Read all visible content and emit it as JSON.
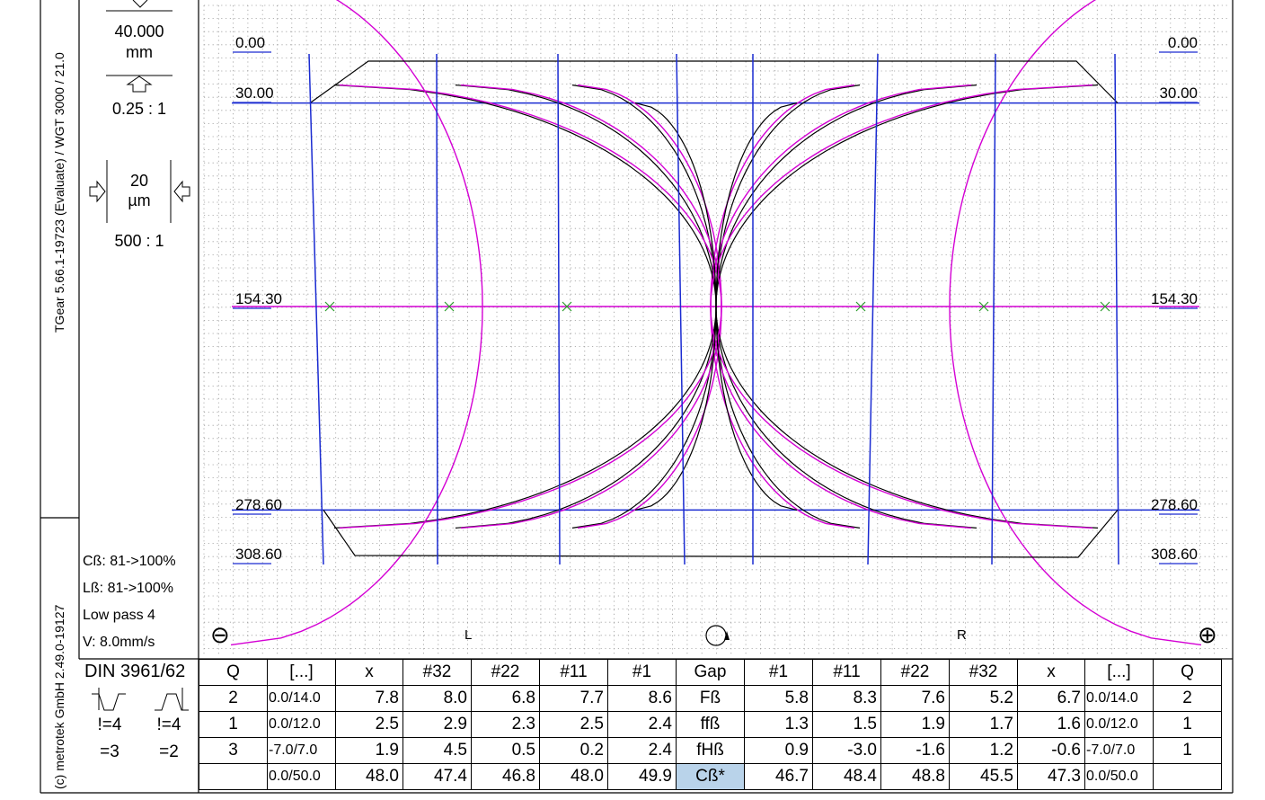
{
  "sidebar": {
    "vertical_top": "TGear 5.66.1-19723 (Evaluate) / WGT 3000 / 21.0",
    "vertical_bottom": "(c) metrotek GmbH 2.49.0-19127",
    "length_value": "40.000",
    "length_unit": "mm",
    "length_scale": "0.25 : 1",
    "deviation_value": "20",
    "deviation_unit": "µm",
    "deviation_scale": "500 : 1",
    "info": [
      "Cß: 81->100%",
      "Lß: 81->100%",
      "Low pass 4",
      "V: 8.0mm/s"
    ],
    "standard": "DIN 3961/62",
    "q_left": "!=4",
    "q_right": "!=4",
    "eq_left": "=3",
    "eq_right": "=2"
  },
  "plot": {
    "row_labels_left": [
      "0.00",
      "30.00",
      "154.30",
      "278.60",
      "308.60"
    ],
    "row_labels_right": [
      "0.00",
      "30.00",
      "154.30",
      "278.60",
      "308.60"
    ],
    "label_L": "L",
    "label_R": "R",
    "zoom_out": "⊖",
    "zoom_in": "⊕",
    "colors": {
      "measured": "#000000",
      "nominal": "#d400d4",
      "limits": "#1a2bd1",
      "grid": "#9a9a9a"
    }
  },
  "chart_data": {
    "type": "line",
    "y_levels": [
      0.0,
      30.0,
      154.3,
      278.6,
      308.6
    ],
    "grid": true,
    "series": [
      {
        "name": "",
        "values": []
      }
    ]
  },
  "table": {
    "header": [
      "Q",
      "[...]",
      "x",
      "#32",
      "#22",
      "#11",
      "#1",
      "Gap",
      "#1",
      "#11",
      "#22",
      "#32",
      "x",
      "[...]",
      "Q"
    ],
    "rows": [
      [
        "2",
        "0.0/14.0",
        "7.8",
        "8.0",
        "6.8",
        "7.7",
        "8.6",
        "Fß",
        "5.8",
        "8.3",
        "7.6",
        "5.2",
        "6.7",
        "0.0/14.0",
        "2"
      ],
      [
        "1",
        "0.0/12.0",
        "2.5",
        "2.9",
        "2.3",
        "2.5",
        "2.4",
        "ffß",
        "1.3",
        "1.5",
        "1.9",
        "1.7",
        "1.6",
        "0.0/12.0",
        "1"
      ],
      [
        "3",
        "-7.0/7.0",
        "1.9",
        "4.5",
        "0.5",
        "0.2",
        "2.4",
        "fHß",
        "0.9",
        "-3.0",
        "-1.6",
        "1.2",
        "-0.6",
        "-7.0/7.0",
        "1"
      ],
      [
        "",
        "0.0/50.0",
        "48.0",
        "47.4",
        "46.8",
        "48.0",
        "49.9",
        "Cß*",
        "46.7",
        "48.4",
        "48.8",
        "45.5",
        "47.3",
        "0.0/50.0",
        ""
      ]
    ]
  }
}
